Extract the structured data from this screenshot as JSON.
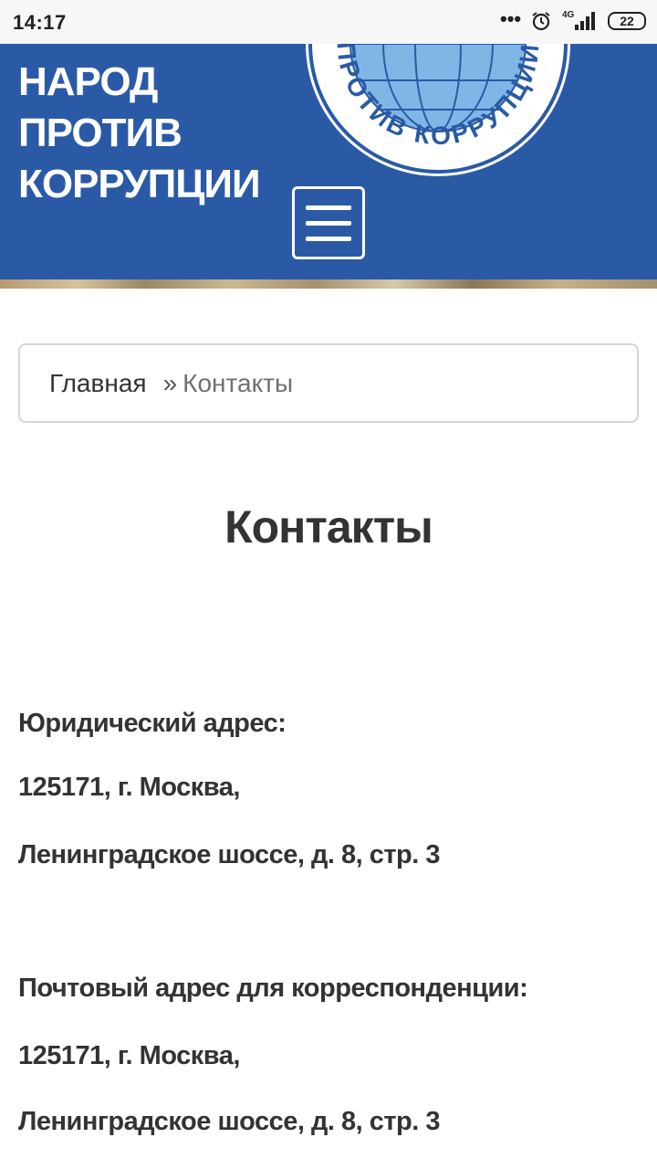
{
  "status_bar": {
    "time": "14:17",
    "dots": "•••",
    "network": "4G",
    "battery": "22"
  },
  "header": {
    "brand_lines": [
      "НАРОД",
      "ПРОТИВ",
      "КОРРУПЦИИ"
    ],
    "emblem_text": "ПРОТИВ КОРРУПЦИИ",
    "background_color": "#2a5aa5"
  },
  "breadcrumb": {
    "home": "Главная",
    "separator": "»",
    "current": "Контакты"
  },
  "page": {
    "title": "Контакты",
    "legal_label": "Юридический адрес:",
    "legal_city": "125171, г. Москва,",
    "legal_street": "Ленинградское шоссе, д. 8, стр. 3",
    "postal_label": "Почтовый адрес для корреспонденции:",
    "postal_city": "125171, г. Москва,",
    "postal_street": "Ленинградское шоссе, д. 8, стр. 3"
  }
}
